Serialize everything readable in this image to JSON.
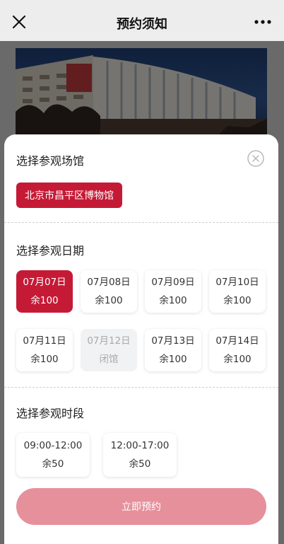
{
  "header": {
    "title": "预约须知"
  },
  "venue_section": {
    "title": "选择参观场馆",
    "selected_venue": "北京市昌平区博物馆"
  },
  "date_section": {
    "title": "选择参观日期",
    "dates": [
      {
        "date": "07月07日",
        "status": "余100",
        "selected": true,
        "closed": false
      },
      {
        "date": "07月08日",
        "status": "余100",
        "selected": false,
        "closed": false
      },
      {
        "date": "07月09日",
        "status": "余100",
        "selected": false,
        "closed": false
      },
      {
        "date": "07月10日",
        "status": "余100",
        "selected": false,
        "closed": false
      },
      {
        "date": "07月11日",
        "status": "余100",
        "selected": false,
        "closed": false
      },
      {
        "date": "07月12日",
        "status": "闭馆",
        "selected": false,
        "closed": true
      },
      {
        "date": "07月13日",
        "status": "余100",
        "selected": false,
        "closed": false
      },
      {
        "date": "07月14日",
        "status": "余100",
        "selected": false,
        "closed": false
      }
    ]
  },
  "time_section": {
    "title": "选择参观时段",
    "slots": [
      {
        "time": "09:00-12:00",
        "status": "余50"
      },
      {
        "time": "12:00-17:00",
        "status": "余50"
      }
    ]
  },
  "actions": {
    "book_label": "立即预约"
  },
  "colors": {
    "accent": "#c51a36",
    "button_disabled": "#e6909c"
  }
}
